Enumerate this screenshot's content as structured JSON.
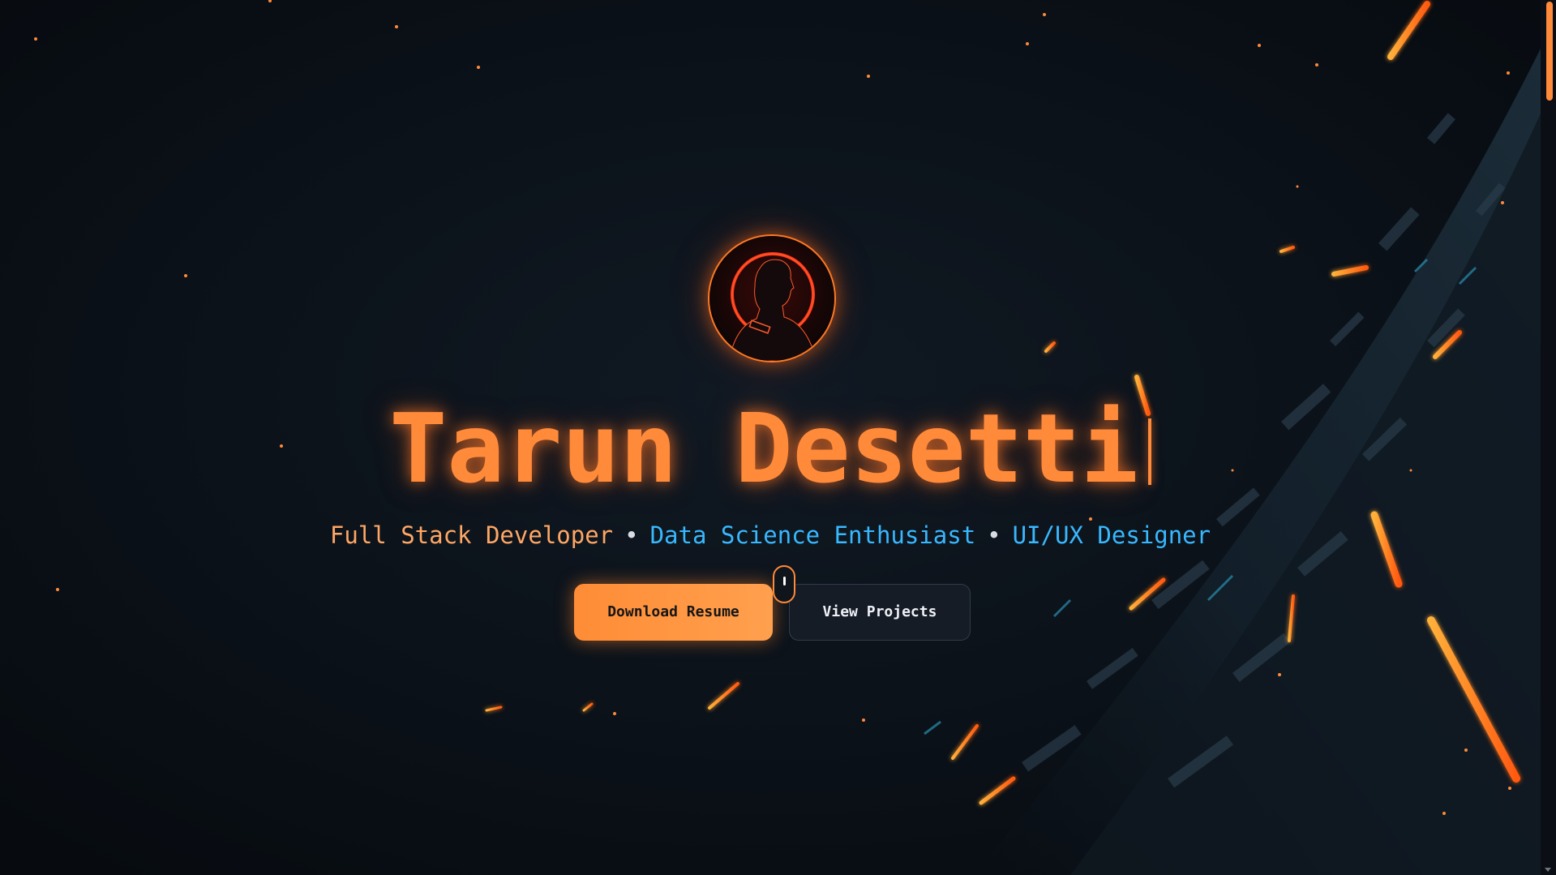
{
  "hero": {
    "name": "Tarun Desetti",
    "roles": [
      {
        "label": "Full Stack Developer",
        "color": "#ffa765"
      },
      {
        "label": "Data Science Enthusiast",
        "color": "#38b8ff"
      },
      {
        "label": "UI/UX Designer",
        "color": "#38b8ff"
      }
    ],
    "role_separator": "•",
    "download_resume_label": "Download Resume",
    "view_projects_label": "View Projects"
  },
  "icons": {
    "avatar": "profile-avatar-icon",
    "scroll": "mouse-scroll-icon"
  },
  "theme": {
    "accent": "#ff8a3a",
    "secondary_accent": "#38b8ff",
    "background": "#0b1017"
  },
  "scrollbar": {
    "position_fraction": 0.0
  }
}
